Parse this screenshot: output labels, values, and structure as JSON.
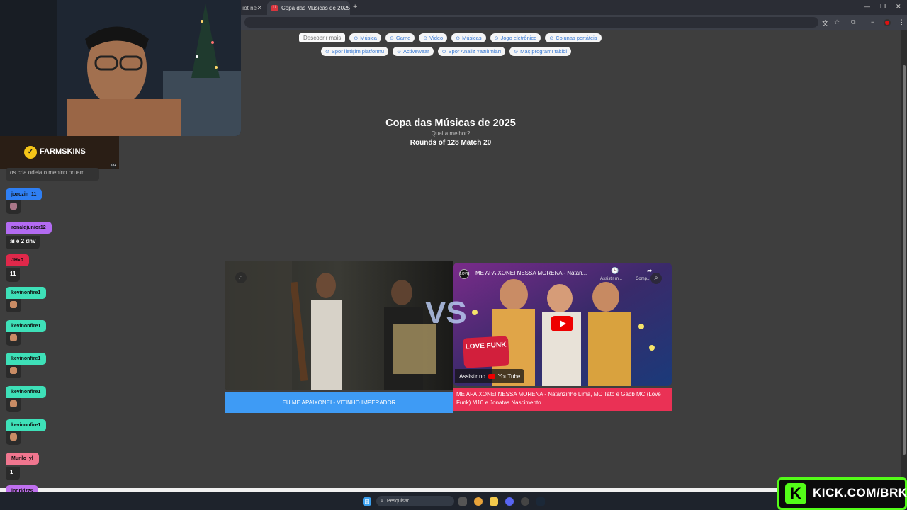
{
  "browser": {
    "tab_inactive_title": "ıot ne",
    "tab_active_title": "Copa das Músicas de 2025",
    "tab_active_favicon": "U",
    "search_chips_lead": "Descobrir mais",
    "chips_row1": [
      "Música",
      "Game",
      "Video",
      "Músicas",
      "Jogo eletrônico",
      "Colunas portáteis"
    ],
    "chips_row2": [
      "Spor iletişim platformu",
      "Activewear",
      "Spor Analiz Yazılımları",
      "Maç programı takibi"
    ]
  },
  "page": {
    "title": "Copa das Músicas de 2025",
    "subtitle": "Qual a melhor?",
    "round": "Rounds of 128 Match 20",
    "vs": "VS"
  },
  "match": {
    "left_label": "EU ME APAIXONEI - VITINHO IMPERADOR",
    "right_label": "ME APAIXONEI NESSA MORENA - Natanzinho Lima, MC Tato e Gabb MC (Love Funk) M10 e Jonatas Nascimento",
    "right_video_title": "ME APAIXONEI NESSA MORENA - Natan...",
    "right_video_logo": "LOVE",
    "right_watch_later": "Assistir m...",
    "right_share": "Comp...",
    "watch_on": "Assistir no",
    "watch_on_brand": "YouTube",
    "love_funk": "LOVE FUNK"
  },
  "overlay": {
    "sponsor": "FARMSKINS",
    "age_badge": "18+",
    "chat_top_message": "os cria odeia o menino oruam",
    "chat": [
      {
        "user": "joaozin_11",
        "color": "#2f7ff3",
        "msg": ""
      },
      {
        "user": "ronaldjunior12",
        "color": "#b36bf2",
        "msg": "ai e 2 dnv"
      },
      {
        "user": "JHx0",
        "color": "#e0284a",
        "msg": "11"
      },
      {
        "user": "kevinonfire1",
        "color": "#3ee0b8",
        "msg": ""
      },
      {
        "user": "kevinonfire1",
        "color": "#3ee0b8",
        "msg": ""
      },
      {
        "user": "kevinonfire1",
        "color": "#3ee0b8",
        "msg": ""
      },
      {
        "user": "kevinonfire1",
        "color": "#3ee0b8",
        "msg": ""
      },
      {
        "user": "kevinonfire1",
        "color": "#3ee0b8",
        "msg": ""
      },
      {
        "user": "Murilo_yl",
        "color": "#f0768f",
        "msg": "1"
      },
      {
        "user": "ingridzzs",
        "color": "#c070f0",
        "msg": ""
      }
    ],
    "kick_url": "KICK.COM/BRKK",
    "kick_logo": "K"
  },
  "taskbar": {
    "search_placeholder": "Pesquisar"
  }
}
